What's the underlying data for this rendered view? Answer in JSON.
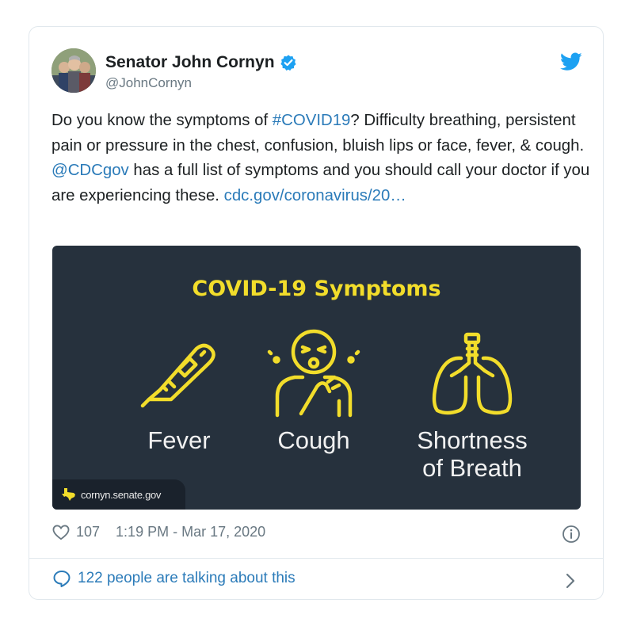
{
  "tweet": {
    "author_name": "Senator John Cornyn",
    "handle": "@JohnCornyn",
    "text": {
      "t1": "Do you know the symptoms of ",
      "hashtag": "#COVID19",
      "t2": "? Difficulty breathing, persistent pain or pressure in the chest, confusion, bluish lips or face, fever, & cough. ",
      "mention": "@CDCgov",
      "t3": " has a full list of symptoms and you should call your doctor if you are experiencing these. ",
      "url": "cdc.gov/coronavirus/20…"
    },
    "media": {
      "title": "COVID-19 Symptoms",
      "symptoms": [
        "Fever",
        "Cough",
        "Shortness",
        "of Breath"
      ],
      "badge_text": "cornyn.senate.gov"
    },
    "likes": "107",
    "timestamp": "1:19 PM - Mar 17, 2020",
    "talking_text": "122 people are talking about this"
  },
  "colors": {
    "link": "#2b7bb9",
    "media_bg": "#26313d",
    "accent_yellow": "#f2dd2b",
    "meta_gray": "#697882"
  },
  "icons": [
    "verified-badge-icon",
    "twitter-bird-icon",
    "thermometer-icon",
    "cough-person-icon",
    "lungs-icon",
    "texas-icon",
    "heart-icon",
    "info-icon",
    "speech-bubble-icon",
    "chevron-right-icon"
  ]
}
